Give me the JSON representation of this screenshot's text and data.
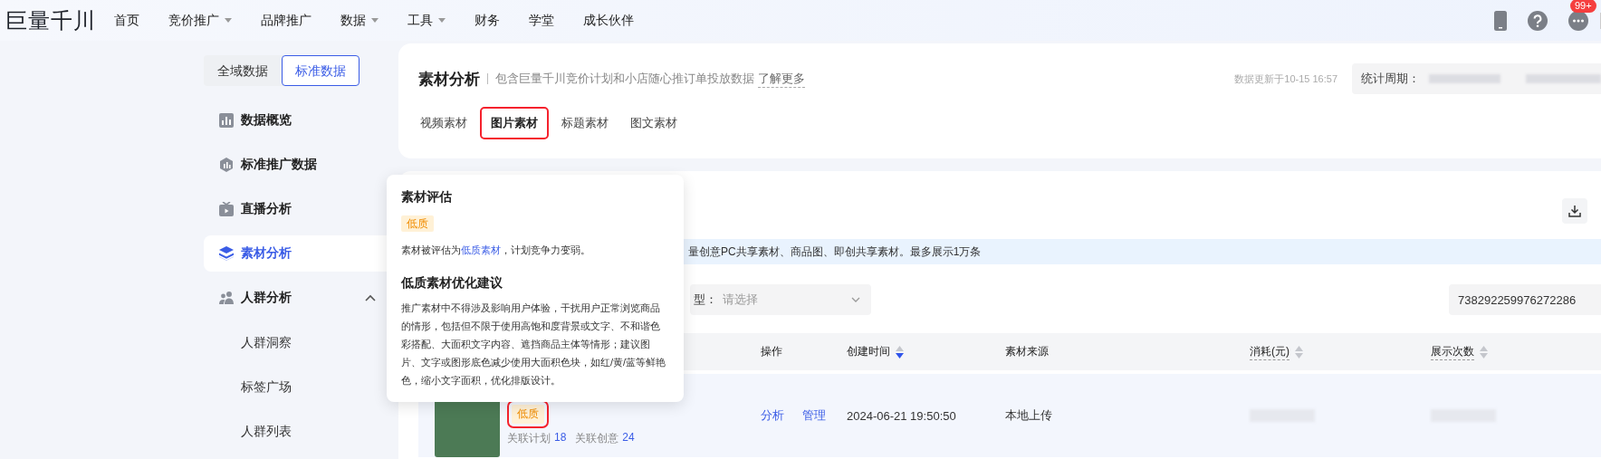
{
  "top_nav": {
    "logo": "巨量千川",
    "items": [
      {
        "label": "首页",
        "has_dropdown": false
      },
      {
        "label": "竞价推广",
        "has_dropdown": true
      },
      {
        "label": "品牌推广",
        "has_dropdown": false
      },
      {
        "label": "数据",
        "has_dropdown": true
      },
      {
        "label": "工具",
        "has_dropdown": true
      },
      {
        "label": "财务",
        "has_dropdown": false
      },
      {
        "label": "学堂",
        "has_dropdown": false
      },
      {
        "label": "成长伙伴",
        "has_dropdown": false
      }
    ],
    "message_badge": "99+"
  },
  "sidebar": {
    "scope_toggle": [
      {
        "label": "全域数据",
        "selected": false
      },
      {
        "label": "标准数据",
        "selected": true
      }
    ],
    "items": [
      {
        "label": "数据概览",
        "selected": false
      },
      {
        "label": "标准推广数据",
        "selected": false
      },
      {
        "label": "直播分析",
        "selected": false
      },
      {
        "label": "素材分析",
        "selected": true
      },
      {
        "label": "人群分析",
        "selected": false,
        "expanded": true,
        "children": [
          {
            "label": "人群洞察"
          },
          {
            "label": "标签广场"
          },
          {
            "label": "人群列表"
          }
        ]
      }
    ]
  },
  "header": {
    "title": "素材分析",
    "subtitle": "包含巨量千川竞价计划和小店随心推订单投放数据",
    "learn_more": "了解更多",
    "updated": "数据更新于10-15 16:57",
    "period_label": "统计周期：",
    "tabs": [
      {
        "label": "视频素材",
        "selected": false,
        "highlighted": false
      },
      {
        "label": "图片素材",
        "selected": true,
        "highlighted": true
      },
      {
        "label": "标题素材",
        "selected": false,
        "highlighted": false
      },
      {
        "label": "图文素材",
        "selected": false,
        "highlighted": false
      }
    ]
  },
  "notice": "量创意PC共享素材、商品图、即创共享素材。最多展示1万条",
  "filters": {
    "type_label": "型：",
    "type_placeholder": "请选择",
    "search_value": "738292259976272286"
  },
  "table": {
    "columns": [
      {
        "label": "操作",
        "tooltip": false
      },
      {
        "label": "创建时间",
        "sorted": true,
        "tooltip": false
      },
      {
        "label": "素材来源",
        "tooltip": false
      },
      {
        "label": "消耗(元)",
        "sorted": false,
        "tooltip": true
      },
      {
        "label": "展示次数",
        "sorted": false,
        "tooltip": true
      }
    ],
    "rows": [
      {
        "quality_tag": "低质",
        "tag_highlighted": true,
        "plans_label": "关联计划",
        "plans": "18",
        "creatives_label": "关联创意",
        "creatives": "24",
        "actions": [
          "分析",
          "管理"
        ],
        "created": "2024-06-21 19:50:50",
        "source": "本地上传"
      }
    ]
  },
  "popover": {
    "title": "素材评估",
    "tag": "低质",
    "evaluation": {
      "before": "素材被评估为",
      "link": "低质素材",
      "after": "，计划竞争力变弱。"
    },
    "advice_title": "低质素材优化建议",
    "advice": "推广素材中不得涉及影响用户体验，干扰用户正常浏览商品的情形，包括但不限于使用高饱和度背景或文字、不和谐色彩搭配、大面积文字内容、遮挡商品主体等情形；建议图片、文字或图形底色减少使用大面积色块，如红/黄/蓝等鲜艳色，缩小文字面积，优化排版设计。"
  }
}
